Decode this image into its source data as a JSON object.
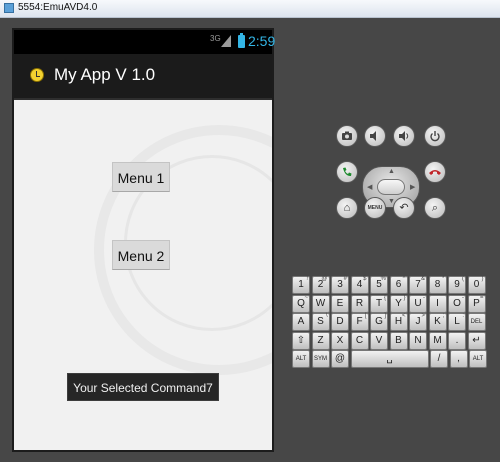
{
  "window": {
    "title": "5554:EmuAVD4.0"
  },
  "status_bar": {
    "network": "3G",
    "time": "2:59"
  },
  "app": {
    "title": "My App V 1.0"
  },
  "content": {
    "menu1_label": "Menu 1",
    "menu2_label": "Menu 2",
    "toast": "Your Selected Command7"
  },
  "emulator_controls": {
    "row1": [
      "camera-icon",
      "volume-down-icon",
      "volume-up-icon",
      "power-icon"
    ],
    "row2": [
      "call-icon",
      "dpad",
      "end-call-icon"
    ],
    "row3_labels": {
      "home": "⌂",
      "menu": "MENU",
      "back": "↶",
      "search": "⌕"
    }
  },
  "keyboard": {
    "row1": [
      {
        "k": "1",
        "s": "!"
      },
      {
        "k": "2",
        "s": "@"
      },
      {
        "k": "3",
        "s": "#"
      },
      {
        "k": "4",
        "s": "$"
      },
      {
        "k": "5",
        "s": "%"
      },
      {
        "k": "6",
        "s": "^"
      },
      {
        "k": "7",
        "s": "&"
      },
      {
        "k": "8",
        "s": "*"
      },
      {
        "k": "9",
        "s": "("
      },
      {
        "k": "0",
        "s": ")"
      }
    ],
    "row2": [
      {
        "k": "Q",
        "s": "~"
      },
      {
        "k": "W",
        "s": "\""
      },
      {
        "k": "E",
        "s": ""
      },
      {
        "k": "R",
        "s": ""
      },
      {
        "k": "T",
        "s": "{"
      },
      {
        "k": "Y",
        "s": "}"
      },
      {
        "k": "U",
        "s": "-"
      },
      {
        "k": "I",
        "s": ""
      },
      {
        "k": "O",
        "s": "-"
      },
      {
        "k": "P",
        "s": "="
      }
    ],
    "row3": [
      {
        "k": "A",
        "s": ""
      },
      {
        "k": "S",
        "s": "\\"
      },
      {
        "k": "D",
        "s": ""
      },
      {
        "k": "F",
        "s": "["
      },
      {
        "k": "G",
        "s": "]"
      },
      {
        "k": "H",
        "s": "<"
      },
      {
        "k": "J",
        "s": ">"
      },
      {
        "k": "K",
        "s": ";"
      },
      {
        "k": "L",
        "s": ":"
      },
      {
        "k": "DEL",
        "s": ""
      }
    ],
    "row4": [
      {
        "k": "⇧",
        "s": ""
      },
      {
        "k": "Z",
        "s": ""
      },
      {
        "k": "X",
        "s": ""
      },
      {
        "k": "C",
        "s": ""
      },
      {
        "k": "V",
        "s": ""
      },
      {
        "k": "B",
        "s": ""
      },
      {
        "k": "N",
        "s": ""
      },
      {
        "k": "M",
        "s": ""
      },
      {
        "k": ".",
        "s": ""
      },
      {
        "k": "↵",
        "s": ""
      }
    ],
    "row5": {
      "alt": "ALT",
      "sym": "SYM",
      "at": "@",
      "space": "␣",
      "slash": "/",
      "comma": ",",
      "alt2": "ALT"
    }
  }
}
